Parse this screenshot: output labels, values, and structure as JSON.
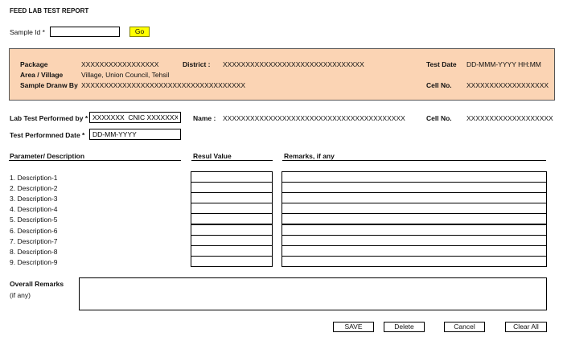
{
  "title": "FEED LAB TEST REPORT",
  "sample": {
    "label": "Sample Id *",
    "value": "",
    "go_label": "Go"
  },
  "info": {
    "package_label": "Package",
    "package_value": "XXXXXXXXXXXXXXXXX",
    "district_label": "District :",
    "district_value": "XXXXXXXXXXXXXXXXXXXXXXXXXXXXXXX",
    "test_date_label": "Test Date",
    "test_date_value": "DD-MMM-YYYY HH:MM",
    "area_label": "Area / Village",
    "area_value": "Village, Union Council, Tehsil",
    "drawn_label": "Sample Dranw By",
    "drawn_value": "XXXXXXXXXXXXXXXXXXXXXXXXXXXXXXXXXXXX",
    "cell_label": "Cell No.",
    "cell_value": "XXXXXXXXXXXXXXXXXX"
  },
  "performer": {
    "label": "Lab Test Performed by *",
    "value": "XXXXXXX  CNIC XXXXXXXX",
    "name_label": "Name :",
    "name_value": "XXXXXXXXXXXXXXXXXXXXXXXXXXXXXXXXXXXXXXXX",
    "cell_label": "Cell No.",
    "cell_value": "XXXXXXXXXXXXXXXXXXX",
    "date_label": "Test Performned Date *",
    "date_value": "DD-MM-YYYY"
  },
  "table": {
    "col_param": "Parameter/ Description",
    "col_result": "Resul Value",
    "col_remarks": "Remarks, if any",
    "rows": [
      {
        "desc": "1. Description-1",
        "result": "",
        "remarks": ""
      },
      {
        "desc": "2. Description-2",
        "result": "",
        "remarks": ""
      },
      {
        "desc": "3. Description-3",
        "result": "",
        "remarks": ""
      },
      {
        "desc": "4. Description-4",
        "result": "",
        "remarks": ""
      },
      {
        "desc": "5. Description-5",
        "result": "",
        "remarks": ""
      },
      {
        "desc": "6. Description-6",
        "result": "",
        "remarks": ""
      },
      {
        "desc": "7. Description-7",
        "result": "",
        "remarks": ""
      },
      {
        "desc": "8. Description-8",
        "result": "",
        "remarks": ""
      },
      {
        "desc": "9. Description-9",
        "result": "",
        "remarks": ""
      }
    ]
  },
  "overall": {
    "label": "Overall Remarks",
    "sublabel": "(if any)",
    "value": ""
  },
  "buttons": {
    "save": "SAVE",
    "delete": "Delete",
    "cancel": "Cancel",
    "clear": "Clear All"
  },
  "colors": {
    "info_band": "#fbd4b4",
    "go_button": "#ffff00"
  }
}
